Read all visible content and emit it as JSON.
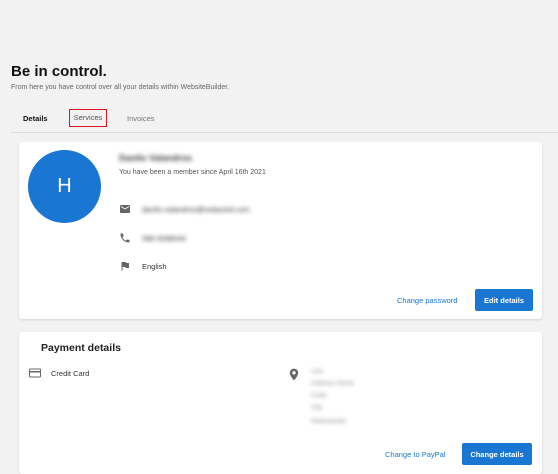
{
  "header": {
    "title": "Be in control.",
    "subtitle": "From here you have control over all your details within WebsiteBuilder."
  },
  "tabs": [
    {
      "label": "Details"
    },
    {
      "label": "Services"
    },
    {
      "label": "Invoices"
    }
  ],
  "profile": {
    "avatar_letter": "H",
    "name": "Danilo Valandros",
    "member_since": "You have been a member since April 16th 2021",
    "email": "danilo.valandros@redacted.com",
    "phone": "088 0098044",
    "language": "English",
    "change_password_label": "Change password",
    "edit_details_label": "Edit details"
  },
  "payment": {
    "title": "Payment details",
    "method": "Credit Card",
    "address_lines": [
      "Line",
      "Address Name",
      "Code",
      "City"
    ],
    "address_extra": "Netherlands",
    "change_paypal_label": "Change to PayPal",
    "change_details_label": "Change details"
  },
  "colors": {
    "accent": "#1976d2",
    "highlight": "#e0141e"
  }
}
